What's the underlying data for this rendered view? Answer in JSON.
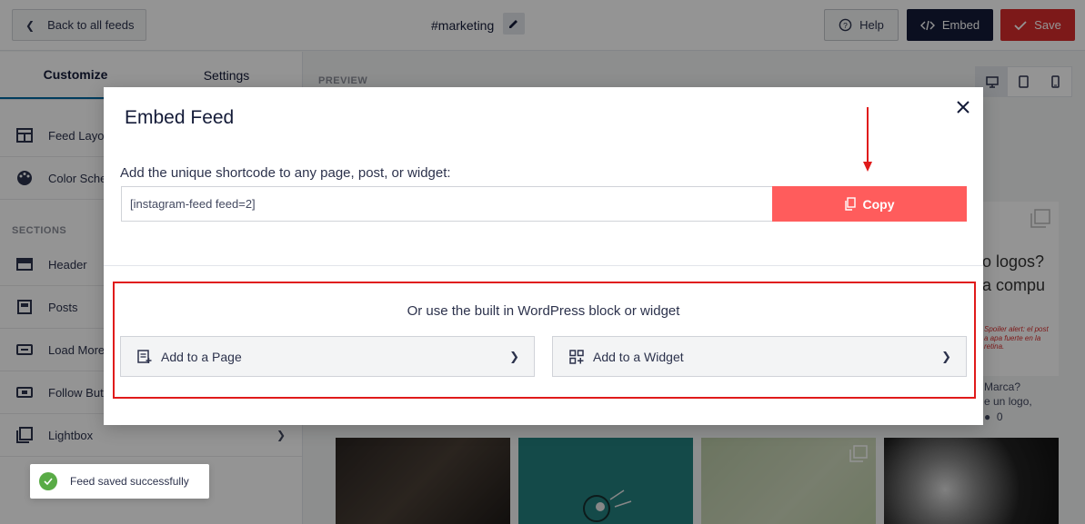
{
  "header": {
    "back_label": "Back to all feeds",
    "feed_name": "#marketing",
    "help_label": "Help",
    "embed_label": "Embed",
    "save_label": "Save"
  },
  "sidebar": {
    "tabs": [
      {
        "label": "Customize",
        "active": true
      },
      {
        "label": "Settings",
        "active": false
      }
    ],
    "items": [
      {
        "label": "Feed Layout",
        "icon": "layout-icon"
      },
      {
        "label": "Color Scheme",
        "icon": "palette-icon"
      }
    ],
    "section_title": "SECTIONS",
    "section_items": [
      {
        "label": "Header",
        "icon": "header-icon"
      },
      {
        "label": "Posts",
        "icon": "posts-icon"
      },
      {
        "label": "Load More Button",
        "icon": "load-more-icon"
      },
      {
        "label": "Follow Button",
        "icon": "follow-icon"
      },
      {
        "label": "Lightbox",
        "icon": "lightbox-icon"
      }
    ]
  },
  "preview": {
    "label": "PREVIEW",
    "post_card": {
      "line1": "o logos?",
      "line2": "a compu",
      "line3": "Spoiler alert: el post",
      "line4": "a apa fuerte en la retina."
    },
    "post_text_line1": "Marca?",
    "post_text_line2": "e un logo,",
    "post_meta": "0"
  },
  "modal": {
    "title": "Embed Feed",
    "instruction": "Add the unique shortcode to any page, post, or widget:",
    "shortcode": "[instagram-feed feed=2]",
    "copy_label": "Copy",
    "or_text": "Or use the built in WordPress block or widget",
    "add_page_label": "Add to a Page",
    "add_widget_label": "Add to a Widget"
  },
  "toast": {
    "message": "Feed saved successfully"
  },
  "colors": {
    "accent_red": "#d72c2c",
    "copy_red": "#ff5c5c",
    "dark": "#141b38",
    "success": "#59ab46"
  }
}
